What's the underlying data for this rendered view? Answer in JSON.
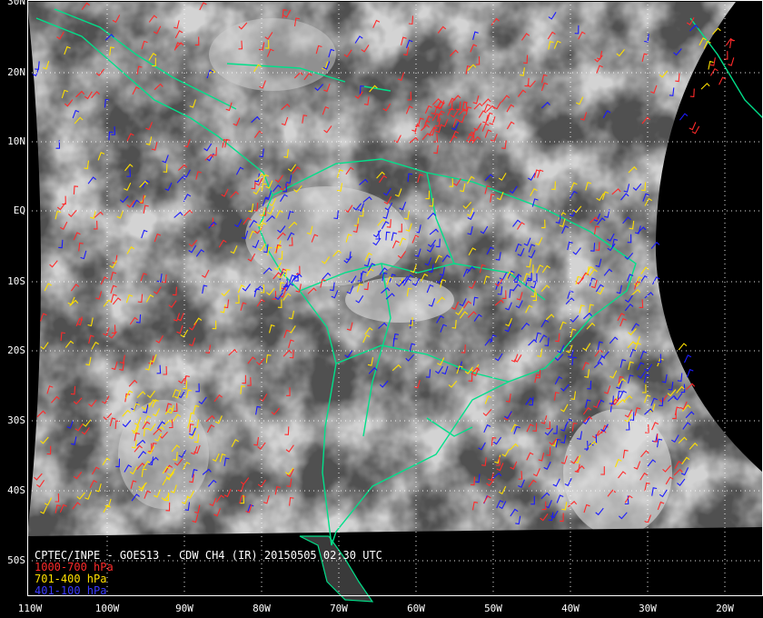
{
  "caption": "CPTEC/INPE - GOES13 - CDW CH4 (IR) 20150505 02:30 UTC",
  "legend": [
    {
      "label": "1000-700 hPa",
      "color": "#ff2a2a"
    },
    {
      "label": "701-400 hPa",
      "color": "#ffe000"
    },
    {
      "label": "401-100 hPa",
      "color": "#1a1aff"
    }
  ],
  "lat_labels": [
    "30N",
    "20N",
    "10N",
    "EQ",
    "10S",
    "20S",
    "30S",
    "40S",
    "50S"
  ],
  "lon_labels": [
    "110W",
    "100W",
    "90W",
    "80W",
    "70W",
    "60W",
    "50W",
    "40W",
    "30W",
    "20W"
  ],
  "colors": {
    "coastline": "#00e08a",
    "grid": "#ffffff",
    "background": "#000000"
  }
}
